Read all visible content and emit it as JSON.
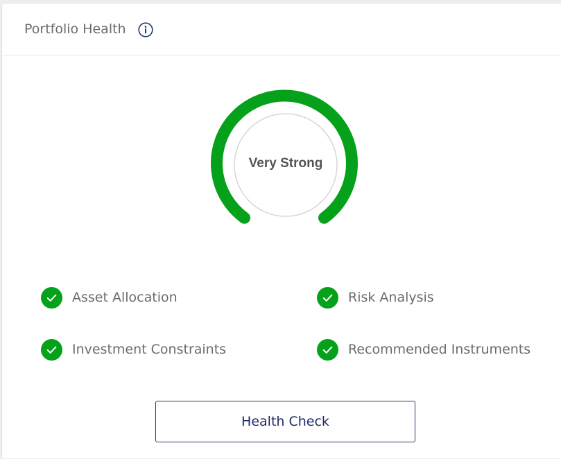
{
  "header": {
    "title": "Portfolio Health",
    "info_icon": "info-icon"
  },
  "gauge": {
    "label": "Very Strong",
    "color": "#05a11a",
    "track_color": "#d6d6d6"
  },
  "checklist": [
    {
      "label": "Asset Allocation",
      "icon": "check-icon",
      "status": "passed"
    },
    {
      "label": "Risk Analysis",
      "icon": "check-icon",
      "status": "passed"
    },
    {
      "label": "Investment Constraints",
      "icon": "check-icon",
      "status": "passed"
    },
    {
      "label": "Recommended Instruments",
      "icon": "check-icon",
      "status": "passed"
    }
  ],
  "actions": {
    "health_check_label": "Health Check"
  },
  "colors": {
    "accent_green": "#05a11a",
    "button_text": "#1f2a6b",
    "text_gray": "#6b6b6b"
  }
}
